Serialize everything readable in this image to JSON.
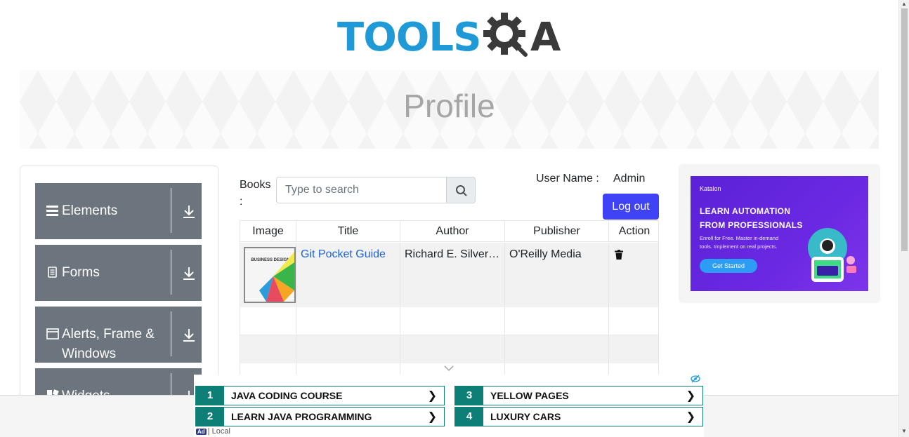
{
  "logo": {
    "text": "TOOLS",
    "suffix": "A",
    "colors": {
      "blue": "#1f9ad6",
      "dark": "#3a3a3a"
    }
  },
  "header": {
    "title": "Profile"
  },
  "sidebar": {
    "groups": [
      {
        "label": "Elements",
        "icon": "hamburger-icon"
      },
      {
        "label": "Forms",
        "icon": "document-icon"
      },
      {
        "label": "Alerts, Frame & Windows",
        "icon": "window-icon"
      },
      {
        "label": "Widgets",
        "icon": "widgets-icon"
      }
    ]
  },
  "books": {
    "label": "Books :",
    "search_placeholder": "Type to search",
    "search_icon": "search-icon"
  },
  "user": {
    "label": "User Name :",
    "value": "Admin",
    "logout_label": "Log out",
    "logout_color": "#3f42f5"
  },
  "table": {
    "columns": [
      "Image",
      "Title",
      "Author",
      "Publisher",
      "Action"
    ],
    "rows": [
      {
        "image_text": "BUSINESS DESIGN",
        "title": "Git Pocket Guide",
        "author": "Richard E. Silverman",
        "publisher": "O'Reilly Media",
        "action_icon": "trash-icon"
      }
    ]
  },
  "side_ad": {
    "brand": "Katalon",
    "headline_1": "LEARN AUTOMATION",
    "headline_2": "FROM PROFESSIONALS",
    "sub": "Enroll for Free. Master in-demand tools. Implement on real projects.",
    "cta": "Get Started"
  },
  "bottom_ad": {
    "links": [
      {
        "num": "1",
        "text": "JAVA CODING COURSE"
      },
      {
        "num": "3",
        "text": "YELLOW PAGES"
      },
      {
        "num": "2",
        "text": "LEARN JAVA PROGRAMMING"
      },
      {
        "num": "4",
        "text": "LUXURY CARS"
      }
    ],
    "arrow": "❯",
    "ad_badge": "Ad",
    "tag": "| Local",
    "accent": "#0d7f77"
  }
}
